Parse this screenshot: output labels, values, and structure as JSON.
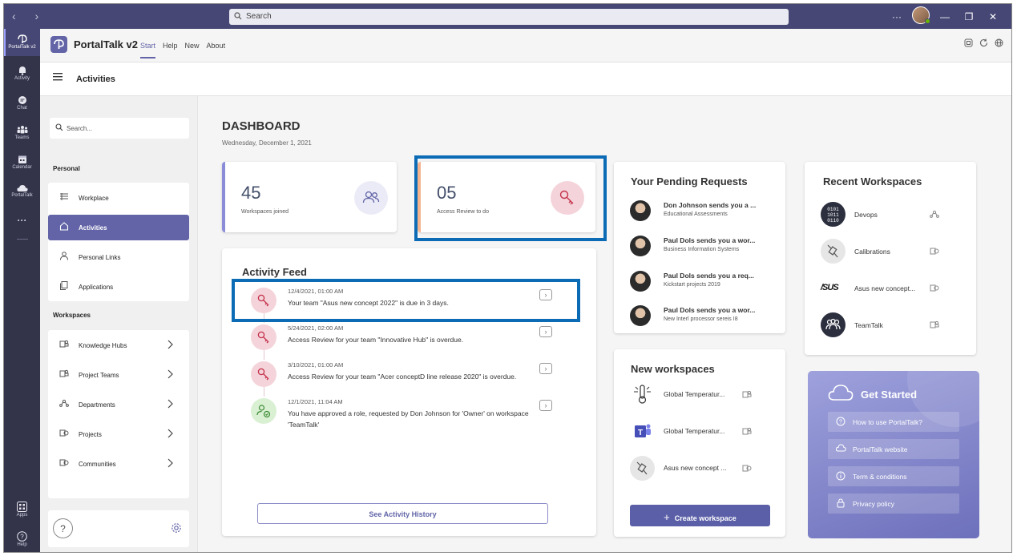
{
  "titlebar": {
    "search_placeholder": "Search",
    "more": "···"
  },
  "rail": [
    {
      "label": "PortalTalk v2",
      "icon": "portaltalk-icon"
    },
    {
      "label": "Activity",
      "icon": "bell-icon"
    },
    {
      "label": "Chat",
      "icon": "chat-icon"
    },
    {
      "label": "Teams",
      "icon": "teams-icon"
    },
    {
      "label": "Calendar",
      "icon": "calendar-icon"
    },
    {
      "label": "PortalTalk",
      "icon": "cloud-icon"
    },
    {
      "label": "···",
      "icon": "more-icon"
    },
    {
      "label": "Apps",
      "icon": "apps-icon"
    },
    {
      "label": "Help",
      "icon": "help-icon"
    }
  ],
  "app": {
    "title": "PortalTalk v2",
    "tabs": [
      "Start",
      "Help",
      "New",
      "About"
    ]
  },
  "subbar": {
    "title": "Activities"
  },
  "leftpanel": {
    "search_placeholder": "Search...",
    "personal_heading": "Personal",
    "personal_items": [
      "Workplace",
      "Activities",
      "Personal Links",
      "Applications"
    ],
    "workspaces_heading": "Workspaces",
    "workspace_items": [
      "Knowledge Hubs",
      "Project Teams",
      "Departments",
      "Projects",
      "Communities"
    ],
    "help": "?"
  },
  "dashboard": {
    "title": "DASHBOARD",
    "date": "Wednesday, December 1, 2021",
    "stats": [
      {
        "value": "45",
        "label": "Workspaces joined",
        "accent": "#8b8cd8"
      },
      {
        "value": "05",
        "label": "Access Review to do",
        "accent": "#f4b48f"
      }
    ]
  },
  "feed": {
    "title": "Activity Feed",
    "items": [
      {
        "time": "12/4/2021, 01:00 AM",
        "text": "Your team \"Asus new concept 2022\" is due in 3 days.",
        "type": "key"
      },
      {
        "time": "5/24/2021, 02:00 AM",
        "text": "Access Review for your team \"Innovative Hub\" is overdue.",
        "type": "key"
      },
      {
        "time": "3/10/2021, 01:00 AM",
        "text": "Access Review for your team \"Acer conceptD line release 2020\" is overdue.",
        "type": "key"
      },
      {
        "time": "12/1/2021, 11:04 AM",
        "text": "You have approved a role, requested by Don Johnson for 'Owner' on workspace 'TeamTalk'",
        "type": "approved"
      }
    ],
    "history_button": "See Activity History"
  },
  "pending": {
    "title": "Your Pending Requests",
    "items": [
      {
        "title": "Don Johnson sends you a ...",
        "sub": "Educational Assessments"
      },
      {
        "title": "Paul Dols sends you a wor...",
        "sub": "Business Information Systems"
      },
      {
        "title": "Paul Dols sends you a req...",
        "sub": "Kickstart projects 2019"
      },
      {
        "title": "Paul Dols sends you a wor...",
        "sub": "New Interl processor sereis I8"
      }
    ]
  },
  "new_ws": {
    "title": "New workspaces",
    "items": [
      "Global Temperatur...",
      "Global Temperatur...",
      "Asus new concept ..."
    ],
    "create_button": "Create workspace"
  },
  "recent": {
    "title": "Recent Workspaces",
    "items": [
      {
        "name": "Devops",
        "logo": "0101\n1011\n0110"
      },
      {
        "name": "Calibrations",
        "logo": ""
      },
      {
        "name": "Asus new concept...",
        "logo": "/SUS"
      },
      {
        "name": "TeamTalk",
        "logo": ""
      }
    ]
  },
  "get_started": {
    "title": "Get Started",
    "links": [
      "How to use PortalTalk?",
      "PortalTalk website",
      "Term & conditions",
      "Privacy policy"
    ]
  }
}
